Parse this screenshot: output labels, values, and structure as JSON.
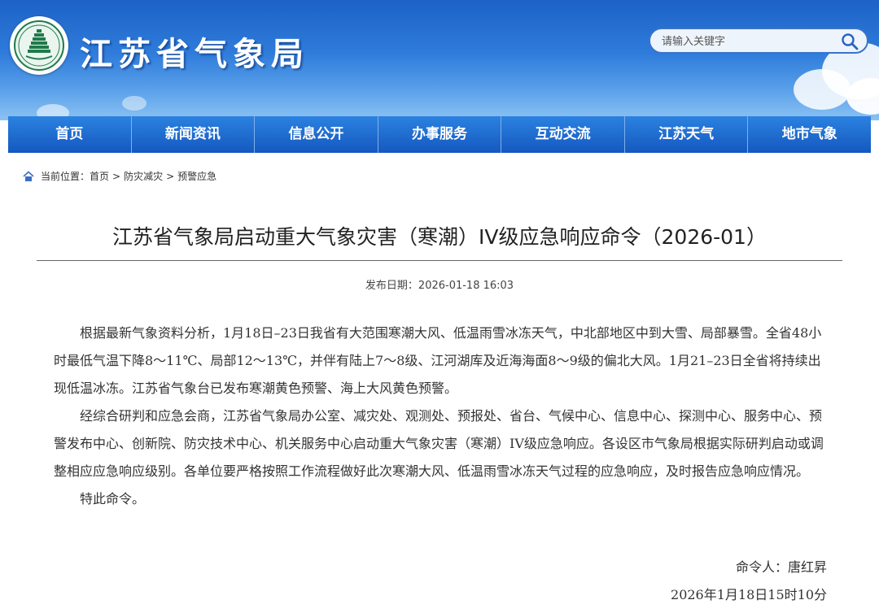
{
  "header": {
    "site_title": "江苏省气象局",
    "search_placeholder": "请输入关键字"
  },
  "nav": {
    "items": [
      "首页",
      "新闻资讯",
      "信息公开",
      "办事服务",
      "互动交流",
      "江苏天气",
      "地市气象"
    ]
  },
  "breadcrumb": {
    "prefix": "当前位置：",
    "items": [
      "首页",
      "防灾减灾",
      "预警应急"
    ],
    "separator": ">"
  },
  "article": {
    "title": "江苏省气象局启动重大气象灾害（寒潮）IV级应急响应命令（2026-01）",
    "date_label": "发布日期：",
    "date_value": "2026-01-18 16:03",
    "paragraphs": [
      "根据最新气象资料分析，1月18日–23日我省有大范围寒潮大风、低温雨雪冰冻天气，中北部地区中到大雪、局部暴雪。全省48小时最低气温下降8～11℃、局部12～13℃，并伴有陆上7～8级、江河湖库及近海海面8～9级的偏北大风。1月21–23日全省将持续出现低温冰冻。江苏省气象台已发布寒潮黄色预警、海上大风黄色预警。",
      "经综合研判和应急会商，江苏省气象局办公室、减灾处、观测处、预报处、省台、气候中心、信息中心、探测中心、服务中心、预警发布中心、创新院、防灾技术中心、机关服务中心启动重大气象灾害（寒潮）IV级应急响应。各设区市气象局根据实际研判启动或调整相应应急响应级别。各单位要严格按照工作流程做好此次寒潮大风、低温雨雪冰冻天气过程的应急响应，及时报告应急响应情况。",
      "特此命令。"
    ],
    "signer_label": "命令人：",
    "signer_name": "唐红昇",
    "sign_date": "2026年1月18日15时10分"
  },
  "colors": {
    "header_top": "#1d62c6",
    "nav_bar": "#1558c0",
    "title_text": "#222222"
  }
}
